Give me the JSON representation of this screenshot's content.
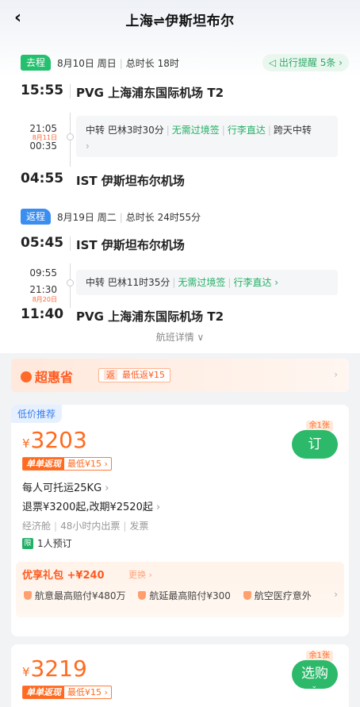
{
  "nav": {
    "back_icon": "‹",
    "title": "上海⇌伊斯坦布尔"
  },
  "outbound": {
    "tag": "去程",
    "date": "8月10日 周日",
    "duration": "总时长 18时",
    "remind": "出行提醒 5条 ›",
    "dep_time": "15:55",
    "dep_airport": "PVG 上海浦东国际机场 T2",
    "transfer_arr": "21:05",
    "transfer_plus": "8月11日",
    "transfer_dep": "00:35",
    "transfer": {
      "city": "中转 巴林3时30分",
      "visa": "无需过境签",
      "luggage": "行李直达",
      "cross": "跨天中转",
      "chev": "›"
    },
    "arr_time": "04:55",
    "arr_airport": "IST 伊斯坦布尔机场"
  },
  "return": {
    "tag": "返程",
    "date": "8月19日 周二",
    "duration": "总时长 24时55分",
    "dep_time": "05:45",
    "dep_airport": "IST 伊斯坦布尔机场",
    "transfer_arr": "09:55",
    "transfer_dep": "21:30",
    "transfer_plus": "8月20日",
    "transfer": {
      "city": "中转 巴林11时35分",
      "visa": "无需过境签",
      "luggage": "行李直达 ›"
    },
    "arr_time": "11:40",
    "arr_airport": "PVG 上海浦东国际机场 T2"
  },
  "flight_detail_link": "航班详情 ∨",
  "super_saver": {
    "logo": "超惠省",
    "icon": "返",
    "tag": "最低返¥15",
    "arrow": "›"
  },
  "offers": [
    {
      "rec_tag": "低价推荐",
      "currency": "¥",
      "price": "3203",
      "cashback_a": "单单返现",
      "cashback_b": "最低¥15 ›",
      "seats_left": "余1张",
      "button": "订",
      "baggage": "每人可托运25KG",
      "refund": "退票¥3200起,改期¥2520起",
      "cabin": "经济舱",
      "ticketing": "48小时内出票",
      "invoice": "发票",
      "limit_icon": "限",
      "limit": "1人预订",
      "gift_title": "优享礼包 +¥240",
      "gift_more": "更换 ›",
      "gift_items": [
        "航意最高赔付¥480万",
        "航延最高赔付¥300",
        "航空医疗意外"
      ],
      "gift_arrow": "›"
    },
    {
      "currency": "¥",
      "price": "3219",
      "cashback_a": "单单返现",
      "cashback_b": "最低¥15 ›",
      "seats_left": "余1张",
      "button": "选购",
      "button_sub": "⌄"
    }
  ],
  "colors": {
    "accent_green": "#2cb96a",
    "price_orange": "#ff6a1e",
    "return_blue": "#3a8ef0"
  }
}
